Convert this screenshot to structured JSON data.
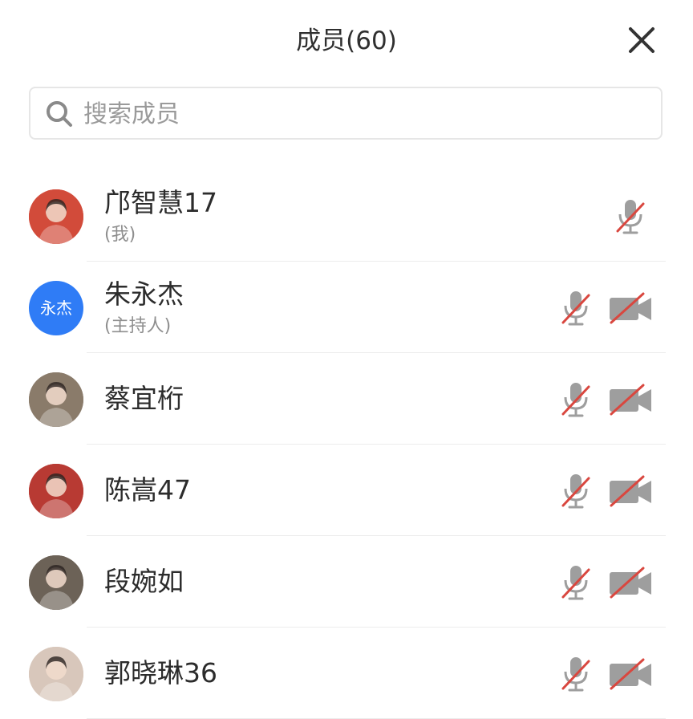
{
  "header": {
    "title": "成员(60)"
  },
  "search": {
    "placeholder": "搜索成员",
    "value": ""
  },
  "members": [
    {
      "name": "邝智慧17",
      "role": "(我)",
      "avatar_text": "",
      "avatar_color": "#d24b3a",
      "mic": "muted",
      "camera": null
    },
    {
      "name": "朱永杰",
      "role": "(主持人)",
      "avatar_text": "永杰",
      "avatar_color": "#2f7cf6",
      "mic": "muted",
      "camera": "off"
    },
    {
      "name": "蔡宜桁",
      "role": "",
      "avatar_text": "",
      "avatar_color": "#8a7b6a",
      "mic": "muted",
      "camera": "off"
    },
    {
      "name": "陈嵩47",
      "role": "",
      "avatar_text": "",
      "avatar_color": "#b83a33",
      "mic": "muted",
      "camera": "off"
    },
    {
      "name": "段婉如",
      "role": "",
      "avatar_text": "",
      "avatar_color": "#6c6257",
      "mic": "muted",
      "camera": "off"
    },
    {
      "name": "郭晓琳36",
      "role": "",
      "avatar_text": "",
      "avatar_color": "#d8c7bb",
      "mic": "muted",
      "camera": "off"
    }
  ],
  "icons": {
    "close": "close-icon",
    "search": "search-icon",
    "mic_muted": "mic-muted-icon",
    "camera_off": "camera-off-icon"
  },
  "colors": {
    "muted_slash": "#d9473f",
    "icon_gray": "#9a9a9a",
    "host_avatar": "#2f7cf6"
  }
}
